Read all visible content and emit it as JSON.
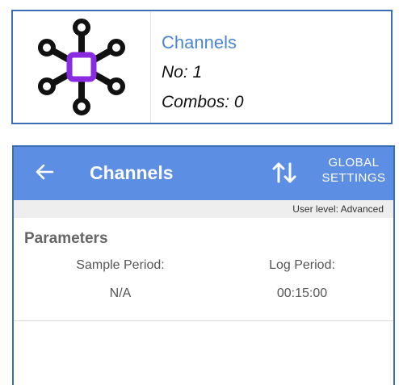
{
  "card": {
    "title": "Channels",
    "no": "No: 1",
    "combos": "Combos: 0",
    "icon": "channels-hub-icon",
    "accent_color": "#8a2be2"
  },
  "appbar": {
    "title": "Channels",
    "back_icon": "arrow-left-icon",
    "sort_icon": "sort-arrows-icon",
    "global_settings_line1": "GLOBAL",
    "global_settings_line2": "SETTINGS",
    "color": "#5c8fe3"
  },
  "user_level": "User level: Advanced",
  "parameters": {
    "title": "Parameters",
    "sample_period_label": "Sample Period:",
    "sample_period_value": "N/A",
    "log_period_label": "Log Period:",
    "log_period_value": "00:15:00"
  }
}
